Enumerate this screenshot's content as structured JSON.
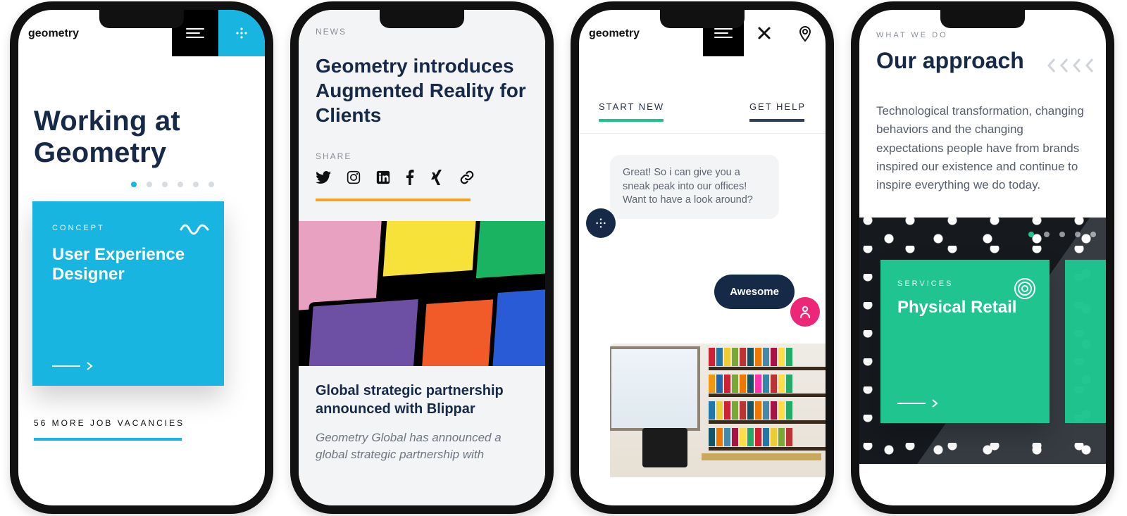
{
  "phone1": {
    "logo": "geometry",
    "title": "Working at Geometry",
    "pager": {
      "count": 6,
      "active": 0
    },
    "card": {
      "eyebrow": "CONCEPT",
      "title": "User Experience Designer"
    },
    "vacancies": "56 MORE JOB VACANCIES"
  },
  "phone2": {
    "kicker": "NEWS",
    "headline": "Geometry introduces Augmented Reality for Clients",
    "share_label": "SHARE",
    "share": [
      "twitter",
      "instagram",
      "linkedin",
      "facebook",
      "xing",
      "link"
    ],
    "article_title": "Global strategic partnership announced with Blippar",
    "excerpt": "Geometry Global has announced a global strategic partnership with"
  },
  "phone3": {
    "logo": "geometry",
    "tabs": {
      "start": "START NEW",
      "help": "GET HELP"
    },
    "bot_msg": "Great! So i can give you a sneak peak into our offices! Want to have a look around?",
    "user_msg": "Awesome"
  },
  "phone4": {
    "kicker": "WHAT WE DO",
    "title": "Our approach",
    "para": "Technological transformation, changing behaviors and the changing expectations people have from brands inspired our existence and continue to inspire everything we do today.",
    "pager": {
      "count": 5,
      "active": 0
    },
    "card": {
      "eyebrow": "SERVICES",
      "title": "Physical Retail"
    }
  }
}
